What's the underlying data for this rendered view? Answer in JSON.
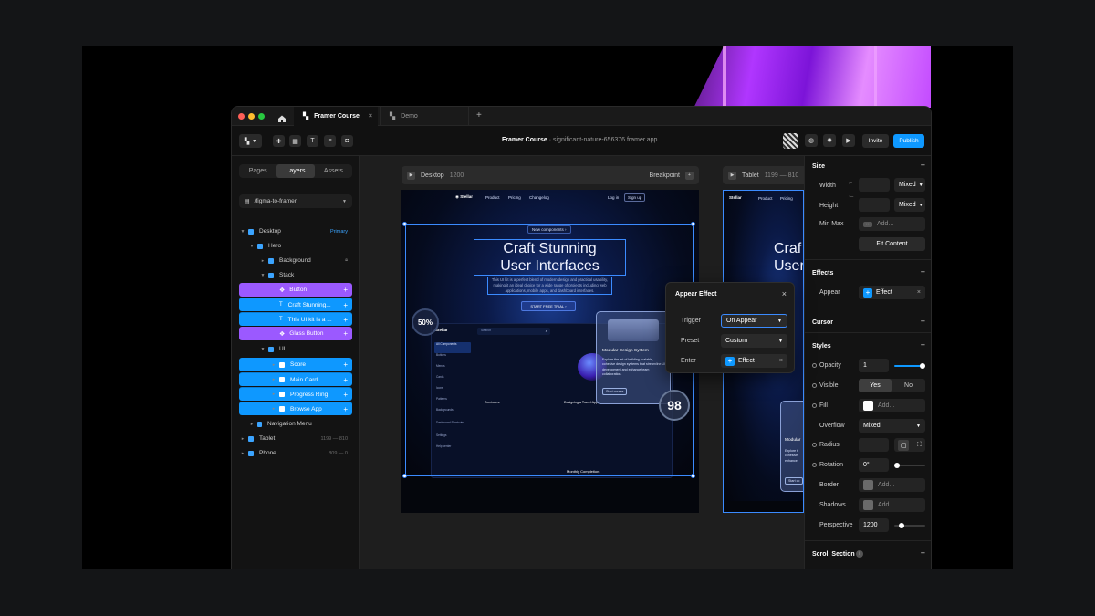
{
  "tabs": [
    {
      "label": "Framer Course",
      "active": true
    },
    {
      "label": "Demo",
      "active": false
    }
  ],
  "toolbar": {
    "project": "Framer Course",
    "url": "· significant-nature-656376.framer.app",
    "invite": "Invite",
    "publish": "Publish"
  },
  "left": {
    "tabs": [
      "Pages",
      "Layers",
      "Assets"
    ],
    "active_tab": "Layers",
    "path": "/figma-to-framer",
    "layers": [
      {
        "label": "Desktop",
        "right": "Primary",
        "state": "none"
      },
      {
        "label": "Hero",
        "right": "",
        "state": "none"
      },
      {
        "label": "Background",
        "right": "",
        "state": "none"
      },
      {
        "label": "Stack",
        "right": "",
        "state": "none"
      },
      {
        "label": "Button",
        "right": "",
        "state": "purple"
      },
      {
        "label": "Craft Stunning...",
        "right": "",
        "state": "blue"
      },
      {
        "label": "This UI kit is a ...",
        "right": "",
        "state": "blue"
      },
      {
        "label": "Glass Button",
        "right": "",
        "state": "purple"
      },
      {
        "label": "UI",
        "right": "",
        "state": "none"
      },
      {
        "label": "Score",
        "right": "",
        "state": "blue"
      },
      {
        "label": "Main Card",
        "right": "",
        "state": "blue"
      },
      {
        "label": "Progress Ring",
        "right": "",
        "state": "blue"
      },
      {
        "label": "Browse App",
        "right": "",
        "state": "blue"
      },
      {
        "label": "Navigation Menu",
        "right": "",
        "state": "none"
      },
      {
        "label": "Tablet",
        "right": "1199 — 810",
        "state": "none"
      },
      {
        "label": "Phone",
        "right": "809 — 0",
        "state": "none"
      }
    ]
  },
  "canvas": {
    "desktop": {
      "name": "Desktop",
      "width": "1200",
      "breakpoint": "Breakpoint"
    },
    "tablet": {
      "name": "Tablet",
      "range": "1199 — 810"
    },
    "site": {
      "brand": "Stellar",
      "nav": [
        "Product",
        "Pricing",
        "Changelog"
      ],
      "login": "Log in",
      "signup": "Sign up",
      "badge": "New components",
      "title_line1": "Craft Stunning",
      "title_line2": "User Interfaces",
      "subtitle": "This UI kit is a perfect blend of modern design and practical usability, making it an ideal choice for a wide range of projects including web applications, mobile apps, and dashboard interfaces.",
      "cta": "START FREE TRIAL",
      "percent": "50%",
      "score": "98",
      "glass_title": "Modular Design System",
      "glass_text": "Explore the art of building scalable, cohesive design systems that streamline UI development and enhance team collaboration.",
      "glass_button": "Start course",
      "tablet_title_1": "Craf",
      "tablet_title_2": "User",
      "tablet_modular": "Modular",
      "tablet_explore": "Explore t",
      "tablet_cohesive": "cohesive",
      "tablet_enhance": "enhance",
      "tablet_start": "Start co",
      "dash_brand": "Stellar",
      "dash_search": "Search",
      "dash_items": [
        "All Components",
        "Buttons",
        "Menus",
        "Cards",
        "Icons",
        "Patterns",
        "Backgrounds",
        "Dashboard Shortcuts",
        "Settings",
        "Help center"
      ],
      "dash_heading": "Designing a Travel App",
      "dash_footer": "Monthly Completion",
      "dash_reminders": "Reminders"
    }
  },
  "popover": {
    "title": "Appear Effect",
    "trigger_label": "Trigger",
    "trigger_value": "On Appear",
    "preset_label": "Preset",
    "preset_value": "Custom",
    "enter_label": "Enter",
    "enter_value": "Effect"
  },
  "right": {
    "size": {
      "title": "Size",
      "width_label": "Width",
      "width_mode": "Mixed",
      "height_label": "Height",
      "height_mode": "Mixed",
      "minmax_label": "Min Max",
      "minmax_value": "Add...",
      "fit_button": "Fit Content"
    },
    "effects": {
      "title": "Effects",
      "appear_label": "Appear",
      "appear_value": "Effect"
    },
    "cursor": {
      "title": "Cursor"
    },
    "styles": {
      "title": "Styles",
      "opacity_label": "Opacity",
      "opacity_value": "1",
      "visible_label": "Visible",
      "visible_yes": "Yes",
      "visible_no": "No",
      "fill_label": "Fill",
      "fill_value": "Add...",
      "overflow_label": "Overflow",
      "overflow_value": "Mixed",
      "radius_label": "Radius",
      "rotation_label": "Rotation",
      "rotation_value": "0°",
      "border_label": "Border",
      "border_value": "Add...",
      "shadows_label": "Shadows",
      "shadows_value": "Add...",
      "perspective_label": "Perspective",
      "perspective_value": "1200"
    },
    "scroll": {
      "title": "Scroll Section"
    }
  },
  "colors": {
    "accent": "#0e98ff",
    "purple": "#9b59ff",
    "selection": "#3b8bff"
  }
}
